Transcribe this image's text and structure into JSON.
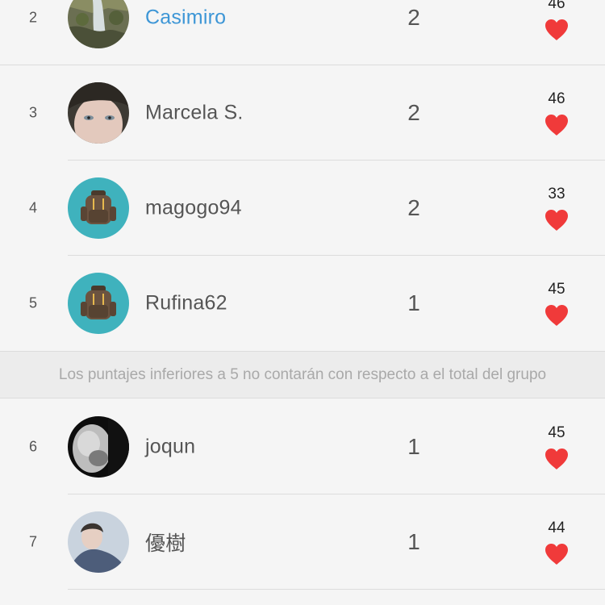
{
  "colors": {
    "background": "#f5f5f5",
    "link": "#3d96d6",
    "heart": "#f03a3a",
    "notice_bg": "#ececec",
    "avatar_teal": "#3fb2bd"
  },
  "rows": [
    {
      "rank": "2",
      "name": "Casimiro",
      "count": "2",
      "likes": "46",
      "avatar": "waterfall-photo"
    },
    {
      "rank": "3",
      "name": "Marcela S.",
      "count": "2",
      "likes": "46",
      "avatar": "face-photo"
    },
    {
      "rank": "4",
      "name": "magogo94",
      "count": "2",
      "likes": "33",
      "avatar": "backpack-icon"
    },
    {
      "rank": "5",
      "name": "Rufina62",
      "count": "1",
      "likes": "45",
      "avatar": "backpack-icon"
    }
  ],
  "notice": "Los puntajes inferiores a 5 no contarán con respecto a el total del grupo",
  "rows_after": [
    {
      "rank": "6",
      "name": "joqun",
      "count": "1",
      "likes": "45",
      "avatar": "bw-portrait-photo"
    },
    {
      "rank": "7",
      "name": "優樹",
      "count": "1",
      "likes": "44",
      "avatar": "person-photo"
    }
  ]
}
